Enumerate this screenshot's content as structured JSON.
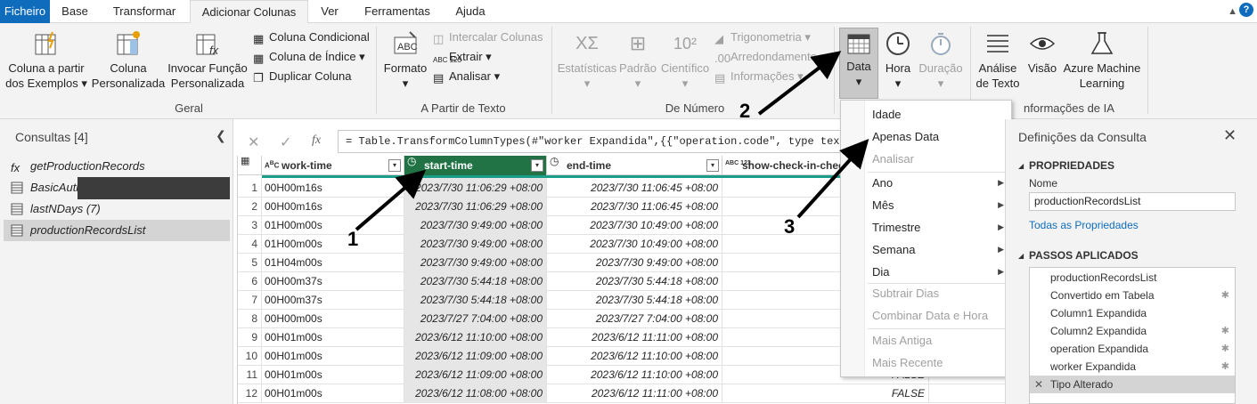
{
  "tabs": [
    "Ficheiro",
    "Base",
    "Transformar",
    "Adicionar Colunas",
    "Ver",
    "Ferramentas",
    "Ajuda"
  ],
  "ribbon": {
    "col_exemplos": [
      "Coluna a partir",
      "dos Exemplos ▾"
    ],
    "col_personalizada": [
      "Coluna",
      "Personalizada"
    ],
    "invocar": [
      "Invocar Função",
      "Personalizada"
    ],
    "col_condicional": "Coluna Condicional",
    "col_indice": "Coluna de Índice ▾",
    "duplicar": "Duplicar Coluna",
    "group_geral": "Geral",
    "formato": "Formato",
    "intercalar": "Intercalar Colunas",
    "extrair": "Extrair ▾",
    "analisar": "Analisar ▾",
    "group_texto": "A Partir de Texto",
    "estatisticas": "Estatísticas",
    "padrao": "Padrão",
    "cientifico": "Científico",
    "trigonometria": "Trigonometria ▾",
    "arredondamento": "Arredondamento ▾",
    "informacoes": "Informações ▾",
    "group_numero": "De Número",
    "data": "Data",
    "hora": "Hora",
    "duracao": "Duração",
    "analise_texto": [
      "Análise",
      "de Texto"
    ],
    "visao": "Visão",
    "azure": [
      "Azure Machine",
      "Learning"
    ],
    "group_ia": "nformações de IA"
  },
  "left_panel": {
    "title": "Consultas [4]",
    "queries": [
      "getProductionRecords",
      "BasicAuth",
      "lastNDays (7)",
      "productionRecordsList"
    ]
  },
  "formula": "= Table.TransformColumnTypes(#\"worker Expandida\",{{\"operation.code\", type text}, {\"op",
  "columns": [
    {
      "type": "ABC",
      "name": "work-time"
    },
    {
      "type": "globe",
      "name": "start-time"
    },
    {
      "type": "globe",
      "name": "end-time"
    },
    {
      "type": "ABC123",
      "name": "show-check-in-checkli"
    }
  ],
  "rows": [
    [
      "1",
      "00H00m16s",
      "2023/7/30 11:06:29 +08:00",
      "2023/7/30 11:06:45 +08:00",
      ""
    ],
    [
      "2",
      "00H00m16s",
      "2023/7/30 11:06:29 +08:00",
      "2023/7/30 11:06:45 +08:00",
      ""
    ],
    [
      "3",
      "01H00m00s",
      "2023/7/30 9:49:00 +08:00",
      "2023/7/30 10:49:00 +08:00",
      ""
    ],
    [
      "4",
      "01H00m00s",
      "2023/7/30 9:49:00 +08:00",
      "2023/7/30 10:49:00 +08:00",
      ""
    ],
    [
      "5",
      "01H04m00s",
      "2023/7/30 9:49:00 +08:00",
      "2023/7/30 9:49:00 +08:00",
      ""
    ],
    [
      "6",
      "00H00m37s",
      "2023/7/30 5:44:18 +08:00",
      "2023/7/30 5:44:18 +08:00",
      ""
    ],
    [
      "7",
      "00H00m37s",
      "2023/7/30 5:44:18 +08:00",
      "2023/7/30 5:44:18 +08:00",
      ""
    ],
    [
      "8",
      "00H00m00s",
      "2023/7/27 7:04:00 +08:00",
      "2023/7/27 7:04:00 +08:00",
      ""
    ],
    [
      "9",
      "00H01m00s",
      "2023/6/12 11:10:00 +08:00",
      "2023/6/12 11:11:00 +08:00",
      ""
    ],
    [
      "10",
      "00H01m00s",
      "2023/6/12 11:09:00 +08:00",
      "2023/6/12 11:10:00 +08:00",
      ""
    ],
    [
      "11",
      "00H01m00s",
      "2023/6/12 11:09:00 +08:00",
      "2023/6/12 11:10:00 +08:00",
      "FALSE"
    ],
    [
      "12",
      "00H01m00s",
      "2023/6/12 11:08:00 +08:00",
      "2023/6/12 11:11:00 +08:00",
      "FALSE"
    ]
  ],
  "date_menu": {
    "idade": "Idade",
    "apenas_data": "Apenas Data",
    "analisar": "Analisar",
    "ano": "Ano",
    "mes": "Mês",
    "trimestre": "Trimestre",
    "semana": "Semana",
    "dia": "Dia",
    "subtrair": "Subtrair Dias",
    "combinar": "Combinar Data e Hora",
    "mais_antiga": "Mais Antiga",
    "mais_recente": "Mais Recente"
  },
  "right_panel": {
    "title": "Definições da Consulta",
    "propriedades": "PROPRIEDADES",
    "nome_label": "Nome",
    "nome_value": "productionRecordsList",
    "todas": "Todas as Propriedades",
    "passos": "PASSOS APLICADOS",
    "steps": [
      "productionRecordsList",
      "Convertido em Tabela",
      "Column1 Expandida",
      "Column2 Expandida",
      "operation Expandida",
      "worker Expandida",
      "Tipo Alterado"
    ]
  },
  "annotations": [
    "1",
    "2",
    "3"
  ],
  "colors": {
    "accent": "#217346",
    "file_tab": "#0f6cbd",
    "selected_button": "#c8c8c8"
  }
}
